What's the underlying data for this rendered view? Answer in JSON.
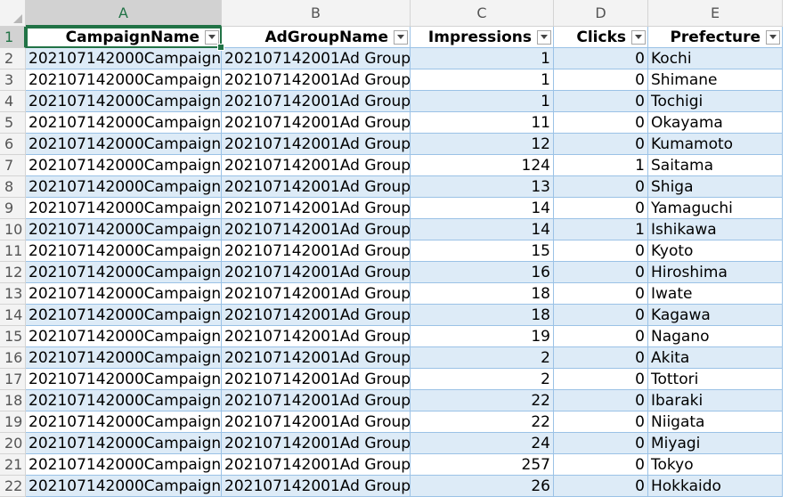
{
  "columns": [
    {
      "letter": "A",
      "header": "CampaignName",
      "align": "left"
    },
    {
      "letter": "B",
      "header": "AdGroupName",
      "align": "left"
    },
    {
      "letter": "C",
      "header": "Impressions",
      "align": "right"
    },
    {
      "letter": "D",
      "header": "Clicks",
      "align": "right"
    },
    {
      "letter": "E",
      "header": "Prefecture",
      "align": "left"
    }
  ],
  "rows": [
    {
      "num": "2",
      "cells": [
        "202107142000Campaign",
        "202107142001Ad Group",
        "1",
        "0",
        "Kochi"
      ]
    },
    {
      "num": "3",
      "cells": [
        "202107142000Campaign",
        "202107142001Ad Group",
        "1",
        "0",
        "Shimane"
      ]
    },
    {
      "num": "4",
      "cells": [
        "202107142000Campaign",
        "202107142001Ad Group",
        "1",
        "0",
        "Tochigi"
      ]
    },
    {
      "num": "5",
      "cells": [
        "202107142000Campaign",
        "202107142001Ad Group",
        "11",
        "0",
        "Okayama"
      ]
    },
    {
      "num": "6",
      "cells": [
        "202107142000Campaign",
        "202107142001Ad Group",
        "12",
        "0",
        "Kumamoto"
      ]
    },
    {
      "num": "7",
      "cells": [
        "202107142000Campaign",
        "202107142001Ad Group",
        "124",
        "1",
        "Saitama"
      ]
    },
    {
      "num": "8",
      "cells": [
        "202107142000Campaign",
        "202107142001Ad Group",
        "13",
        "0",
        "Shiga"
      ]
    },
    {
      "num": "9",
      "cells": [
        "202107142000Campaign",
        "202107142001Ad Group",
        "14",
        "0",
        "Yamaguchi"
      ]
    },
    {
      "num": "10",
      "cells": [
        "202107142000Campaign",
        "202107142001Ad Group",
        "14",
        "1",
        "Ishikawa"
      ]
    },
    {
      "num": "11",
      "cells": [
        "202107142000Campaign",
        "202107142001Ad Group",
        "15",
        "0",
        "Kyoto"
      ]
    },
    {
      "num": "12",
      "cells": [
        "202107142000Campaign",
        "202107142001Ad Group",
        "16",
        "0",
        "Hiroshima"
      ]
    },
    {
      "num": "13",
      "cells": [
        "202107142000Campaign",
        "202107142001Ad Group",
        "18",
        "0",
        "Iwate"
      ]
    },
    {
      "num": "14",
      "cells": [
        "202107142000Campaign",
        "202107142001Ad Group",
        "18",
        "0",
        "Kagawa"
      ]
    },
    {
      "num": "15",
      "cells": [
        "202107142000Campaign",
        "202107142001Ad Group",
        "19",
        "0",
        "Nagano"
      ]
    },
    {
      "num": "16",
      "cells": [
        "202107142000Campaign",
        "202107142001Ad Group",
        "2",
        "0",
        "Akita"
      ]
    },
    {
      "num": "17",
      "cells": [
        "202107142000Campaign",
        "202107142001Ad Group",
        "2",
        "0",
        "Tottori"
      ]
    },
    {
      "num": "18",
      "cells": [
        "202107142000Campaign",
        "202107142001Ad Group",
        "22",
        "0",
        "Ibaraki"
      ]
    },
    {
      "num": "19",
      "cells": [
        "202107142000Campaign",
        "202107142001Ad Group",
        "22",
        "0",
        "Niigata"
      ]
    },
    {
      "num": "20",
      "cells": [
        "202107142000Campaign",
        "202107142001Ad Group",
        "24",
        "0",
        "Miyagi"
      ]
    },
    {
      "num": "21",
      "cells": [
        "202107142000Campaign",
        "202107142001Ad Group",
        "257",
        "0",
        "Tokyo"
      ]
    },
    {
      "num": "22",
      "cells": [
        "202107142000Campaign",
        "202107142001Ad Group",
        "26",
        "0",
        "Hokkaido"
      ]
    }
  ],
  "header_row_num": "1",
  "selection": {
    "active_cell": "A1"
  },
  "colors": {
    "accent": "#217346",
    "band": "#ddebf7",
    "table_border": "#9bc2e6"
  },
  "icons": {
    "filter": "filter-dropdown-icon"
  }
}
